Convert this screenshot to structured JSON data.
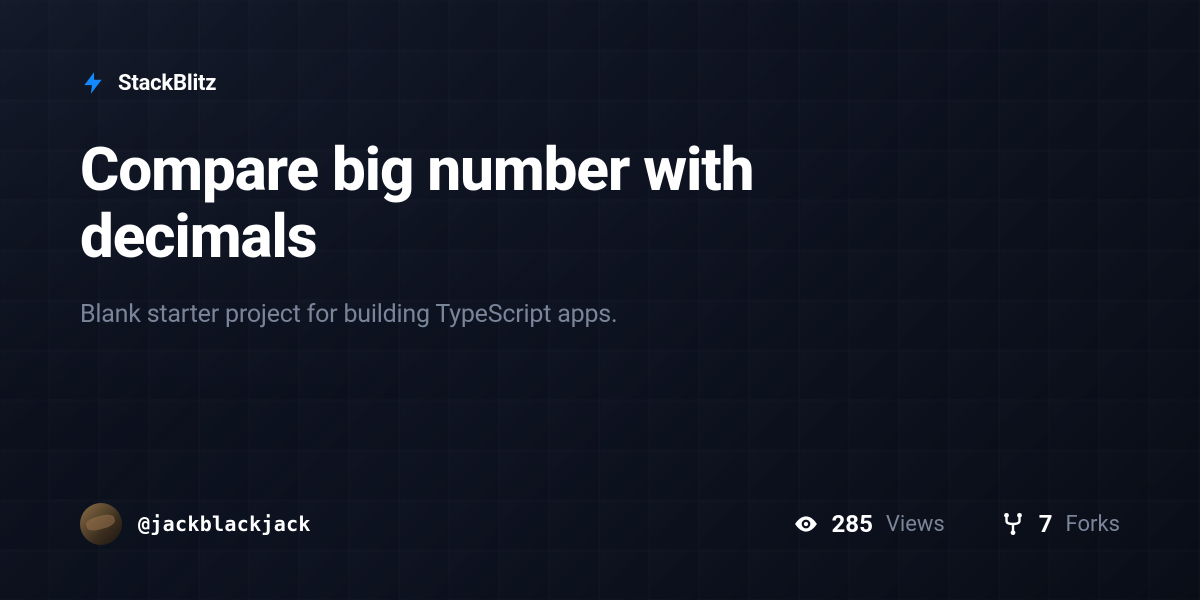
{
  "brand": {
    "name": "StackBlitz"
  },
  "project": {
    "title": "Compare big number with decimals",
    "description": "Blank starter project for building TypeScript apps."
  },
  "author": {
    "username": "@jackblackjack"
  },
  "stats": {
    "views": {
      "value": "285",
      "label": "Views"
    },
    "forks": {
      "value": "7",
      "label": "Forks"
    }
  }
}
